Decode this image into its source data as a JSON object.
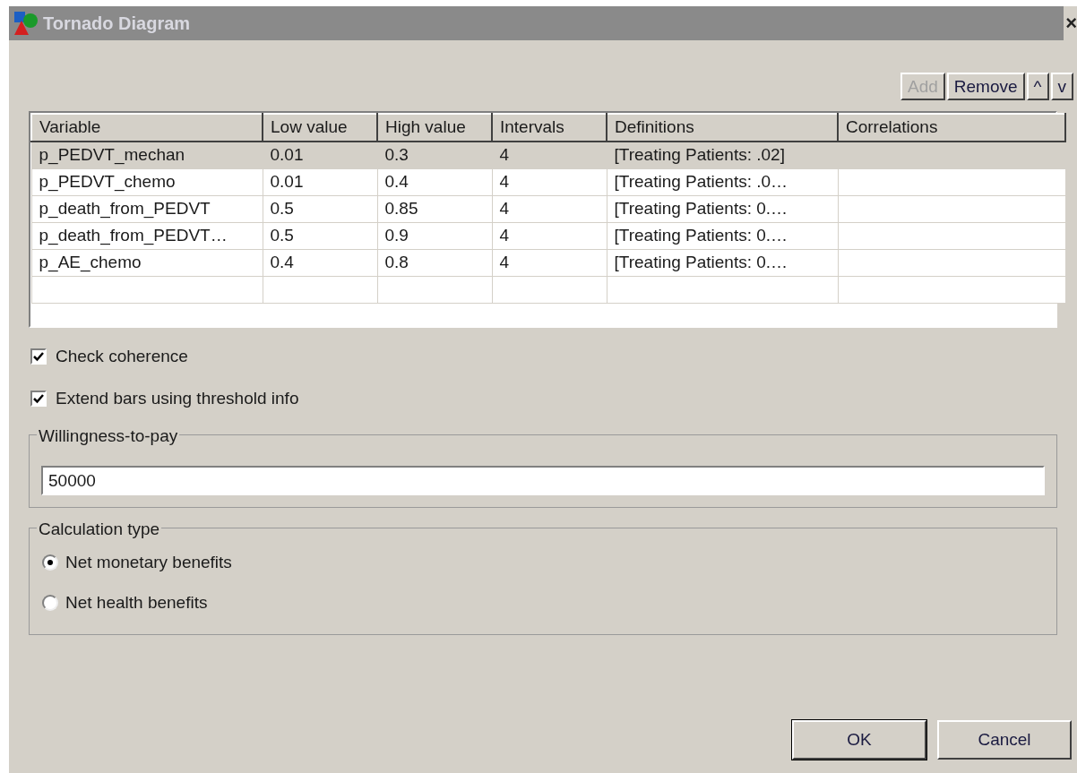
{
  "window": {
    "title": "Tornado Diagram",
    "close": "×"
  },
  "toolbar": [
    {
      "label": "Add",
      "disabled": true
    },
    {
      "label": "Remove",
      "disabled": false
    },
    {
      "label": "^",
      "disabled": false
    },
    {
      "label": "v",
      "disabled": false
    }
  ],
  "table": {
    "columns": [
      "Variable",
      "Low value",
      "High value",
      "Intervals",
      "Definitions",
      "Correlations"
    ],
    "rows": [
      {
        "selected": true,
        "cells": [
          "p_PEDVT_mechan",
          "0.01",
          "0.3",
          "4",
          "[Treating Patients: .02]",
          ""
        ]
      },
      {
        "selected": false,
        "cells": [
          "p_PEDVT_chemo",
          "0.01",
          "0.4",
          "4",
          "[Treating Patients: .0…",
          ""
        ]
      },
      {
        "selected": false,
        "cells": [
          "p_death_from_PEDVT",
          "0.5",
          "0.85",
          "4",
          "[Treating Patients: 0.…",
          ""
        ]
      },
      {
        "selected": false,
        "cells": [
          "p_death_from_PEDVT…",
          "0.5",
          "0.9",
          "4",
          "[Treating Patients: 0.…",
          ""
        ]
      },
      {
        "selected": false,
        "cells": [
          "p_AE_chemo",
          "0.4",
          "0.8",
          "4",
          "[Treating Patients: 0.…",
          ""
        ]
      }
    ]
  },
  "options": [
    {
      "label": "Check coherence",
      "checked": true
    },
    {
      "label": "Extend bars using threshold info",
      "checked": true
    }
  ],
  "willingness": {
    "legend": "Willingness-to-pay",
    "value": "50000"
  },
  "calculation": {
    "legend": "Calculation type",
    "choices": [
      {
        "label": "Net monetary benefits",
        "selected": true
      },
      {
        "label": "Net health benefits",
        "selected": false
      }
    ]
  },
  "buttons": [
    {
      "label": "OK",
      "default": true
    },
    {
      "label": "Cancel",
      "default": false
    }
  ]
}
